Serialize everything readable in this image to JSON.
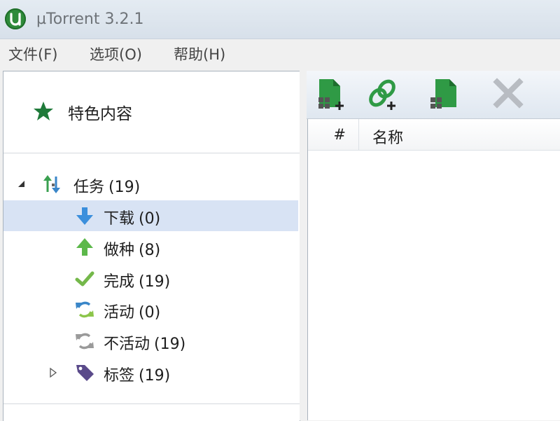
{
  "window": {
    "title": "µTorrent 3.2.1",
    "accent": "#2e8b3a"
  },
  "menu": [
    {
      "label": "文件(F)"
    },
    {
      "label": "选项(O)"
    },
    {
      "label": "帮助(H)"
    }
  ],
  "sidebar": {
    "featured": {
      "label": "特色内容",
      "icon": "star-icon"
    },
    "tree": [
      {
        "label": "任务",
        "count": "(19)",
        "icon": "up-down-arrows-icon",
        "expanded": true
      },
      {
        "label": "下载",
        "count": "(0)",
        "icon": "download-arrow-icon",
        "selected": true
      },
      {
        "label": "做种",
        "count": "(8)",
        "icon": "upload-arrow-icon"
      },
      {
        "label": "完成",
        "count": "(19)",
        "icon": "checkmark-icon"
      },
      {
        "label": "活动",
        "count": "(0)",
        "icon": "active-refresh-icon"
      },
      {
        "label": "不活动",
        "count": "(19)",
        "icon": "inactive-refresh-icon"
      },
      {
        "label": "标签",
        "count": "(19)",
        "icon": "tag-icon",
        "expanded": false
      }
    ]
  },
  "toolbar": {
    "buttons": [
      {
        "name": "add-torrent-icon"
      },
      {
        "name": "add-torrent-from-url-icon"
      },
      {
        "name": "create-torrent-icon"
      },
      {
        "name": "remove-torrent-icon",
        "enabled": false
      }
    ]
  },
  "torrent_list": {
    "columns": [
      "#",
      "名称"
    ]
  }
}
